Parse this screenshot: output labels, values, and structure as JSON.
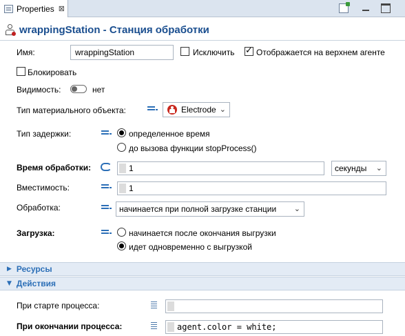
{
  "tab": {
    "label": "Properties",
    "close": "⊠"
  },
  "header": {
    "title": "wrappingStation - Станция обработки"
  },
  "name": {
    "label": "Имя:",
    "value": "wrappingStation"
  },
  "exclude": {
    "label": "Исключить",
    "checked": false
  },
  "top_agent": {
    "label": "Отображается на верхнем агенте",
    "checked": true
  },
  "block": {
    "label": "Блокировать",
    "checked": false
  },
  "visibility": {
    "label": "Видимость:",
    "value": "нет"
  },
  "material_type": {
    "label": "Тип материального объекта:",
    "value": "Electrode"
  },
  "delay_type": {
    "label": "Тип задержки:",
    "options": [
      "определенное время",
      "до вызова функции stopProcess()"
    ],
    "selected": 0
  },
  "process_time": {
    "label": "Время обработки:",
    "value": "1",
    "unit": "секунды"
  },
  "capacity": {
    "label": "Вместимость:",
    "value": "1"
  },
  "processing": {
    "label": "Обработка:",
    "value": "начинается при полной загрузке станции"
  },
  "loading": {
    "label": "Загрузка:",
    "options": [
      "начинается после окончания выгрузки",
      "идет одновременно с выгрузкой"
    ],
    "selected": 1
  },
  "sections": {
    "resources": "Ресурсы",
    "actions": "Действия"
  },
  "on_start": {
    "label": "При старте процесса:",
    "value": ""
  },
  "on_end": {
    "label": "При окончании процесса:",
    "value": "agent.color = white;"
  },
  "colors": {
    "title": "#1a4e8f",
    "accent": "#2c6fb7",
    "section_bg": "#e3ebf5"
  }
}
